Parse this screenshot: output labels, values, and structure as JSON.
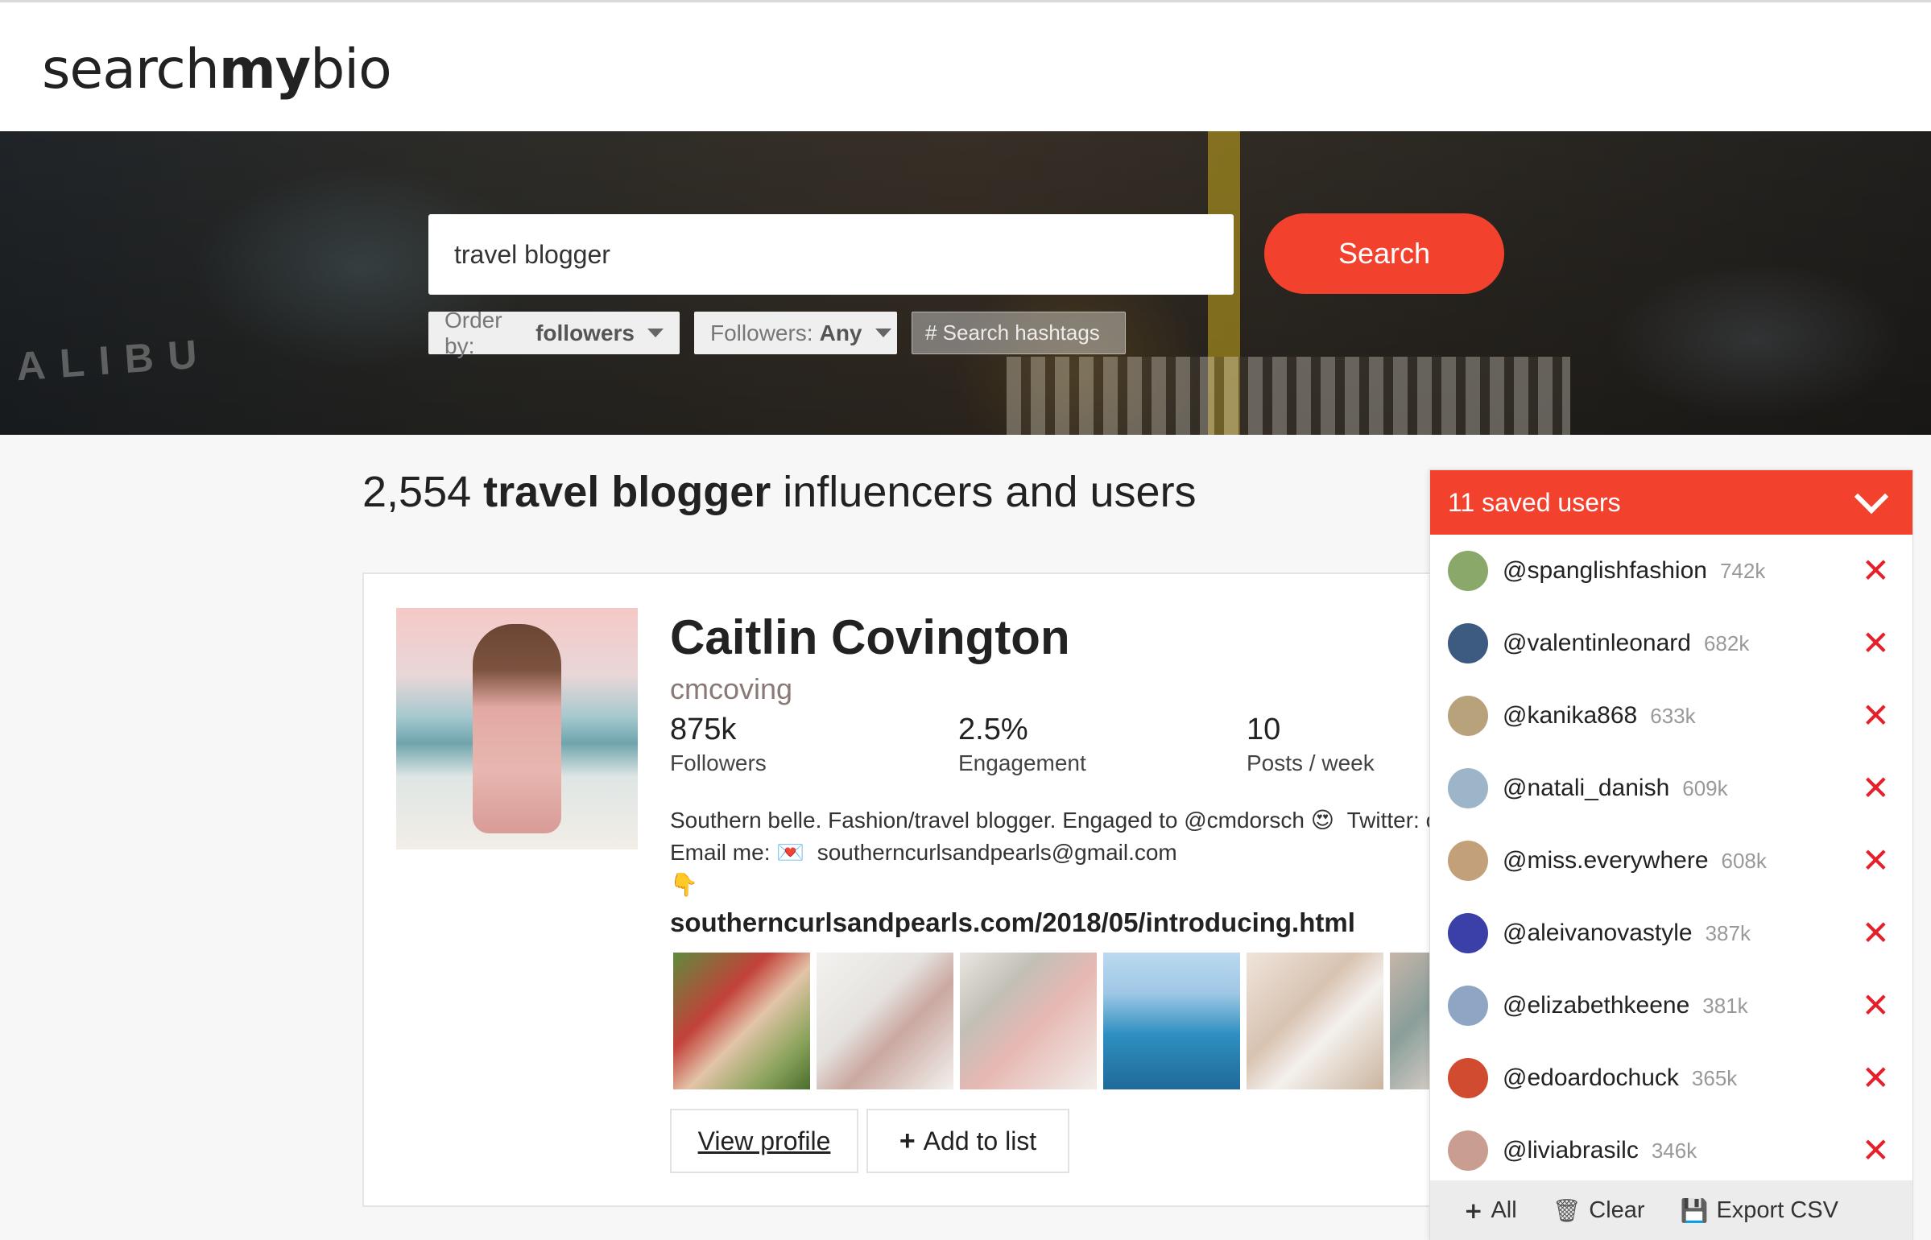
{
  "brand": {
    "logo_light": "search",
    "logo_bold": "my",
    "logo_light2": "bio"
  },
  "search": {
    "query": "travel blogger",
    "button_label": "Search",
    "hashtag_placeholder": "# Search hashtags"
  },
  "filters": {
    "order": {
      "label": "Order by:",
      "value": "followers"
    },
    "followers": {
      "label": "Followers:",
      "value": "Any"
    }
  },
  "results": {
    "count": "2,554",
    "term": "travel blogger",
    "suffix": "influencers and users"
  },
  "profile": {
    "name": "Caitlin Covington",
    "handle": "cmcoving",
    "stats": [
      {
        "value": "875k",
        "label": "Followers"
      },
      {
        "value": "2.5%",
        "label": "Engagement"
      },
      {
        "value": "10",
        "label": "Posts / week"
      }
    ],
    "bio_line1": "Southern belle. Fashion/travel blogger. Engaged to @cmdorsch",
    "bio_line1_emoji": "😍",
    "bio_line1_tail": "Twitter: c",
    "bio_line2": "Email me:",
    "bio_line2_emoji": "💌",
    "bio_email": "southerncurlsandpearls@gmail.com",
    "bio_line3_emoji": "👇",
    "link": "southerncurlsandpearls.com/2018/05/introducing.html",
    "view_profile_label": "View profile",
    "add_to_list_label": "Add to list"
  },
  "saved": {
    "title": "11 saved users",
    "users": [
      {
        "username": "@spanglishfashion",
        "followers": "742k",
        "color": "#8aa86a"
      },
      {
        "username": "@valentinleonard",
        "followers": "682k",
        "color": "#3d5a80"
      },
      {
        "username": "@kanika868",
        "followers": "633k",
        "color": "#b7a27c"
      },
      {
        "username": "@natali_danish",
        "followers": "609k",
        "color": "#9db5c9"
      },
      {
        "username": "@miss.everywhere",
        "followers": "608k",
        "color": "#c2a17a"
      },
      {
        "username": "@aleivanovastyle",
        "followers": "387k",
        "color": "#3b3fa8"
      },
      {
        "username": "@elizabethkeene",
        "followers": "381k",
        "color": "#8fa5c4"
      },
      {
        "username": "@edoardochuck",
        "followers": "365k",
        "color": "#d04b2f"
      },
      {
        "username": "@liviabrasilc",
        "followers": "346k",
        "color": "#c99d8f"
      }
    ],
    "footer": {
      "all_label": "All",
      "clear_label": "Clear",
      "export_label": "Export CSV"
    }
  },
  "icons": {
    "remove": "close-icon",
    "add": "plus-icon",
    "clear": "trash-icon",
    "export": "floppy-disk-icon",
    "collapse": "chevron-down-icon"
  },
  "colors": {
    "accent": "#f2422e",
    "remove": "#e5202a"
  }
}
